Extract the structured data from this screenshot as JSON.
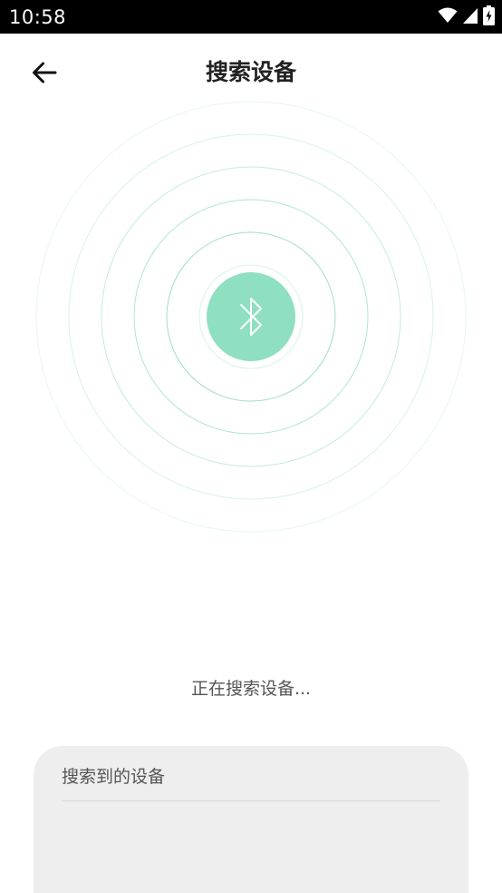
{
  "status_bar": {
    "time": "10:58",
    "icons": [
      "wifi-icon",
      "cellular-signal-icon",
      "battery-charging-icon"
    ]
  },
  "app_bar": {
    "back_icon": "arrow-left-icon",
    "title": "搜索设备"
  },
  "scanner": {
    "center_icon": "bluetooth-icon",
    "accent_color": "#8fdfc1",
    "ring_color": "#7fd3b2",
    "status_text": "正在搜索设备..."
  },
  "results": {
    "title": "搜索到的设备",
    "devices": []
  }
}
